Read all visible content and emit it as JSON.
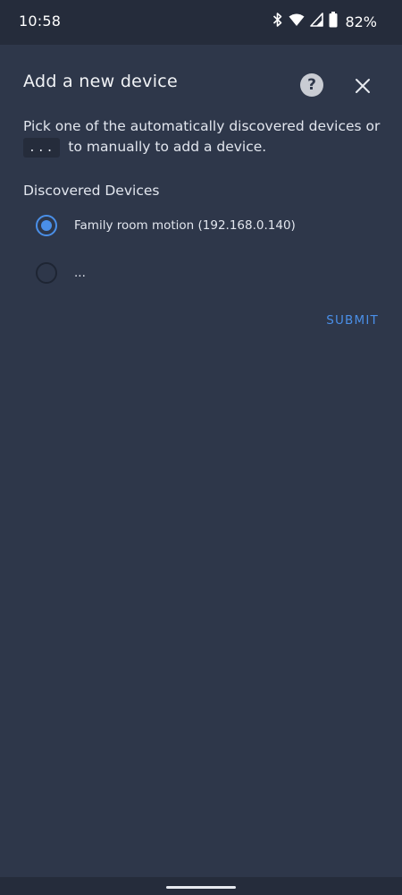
{
  "status_bar": {
    "time": "10:58",
    "battery": "82%",
    "icons": [
      "bluetooth-icon",
      "wifi-icon",
      "cell-signal-icon",
      "battery-icon"
    ]
  },
  "dialog": {
    "title": "Add a new device",
    "description_before": "Pick one of the automatically discovered devices or",
    "code": "...",
    "description_after": "to manually to add a device.",
    "section_label": "Discovered Devices",
    "options": [
      {
        "label": "Family room motion (192.168.0.140)",
        "selected": true
      },
      {
        "label": "...",
        "selected": false
      }
    ],
    "submit_label": "SUBMIT"
  },
  "colors": {
    "background": "#2e374a",
    "status_bar": "#252c3b",
    "accent": "#4a8fe8"
  }
}
